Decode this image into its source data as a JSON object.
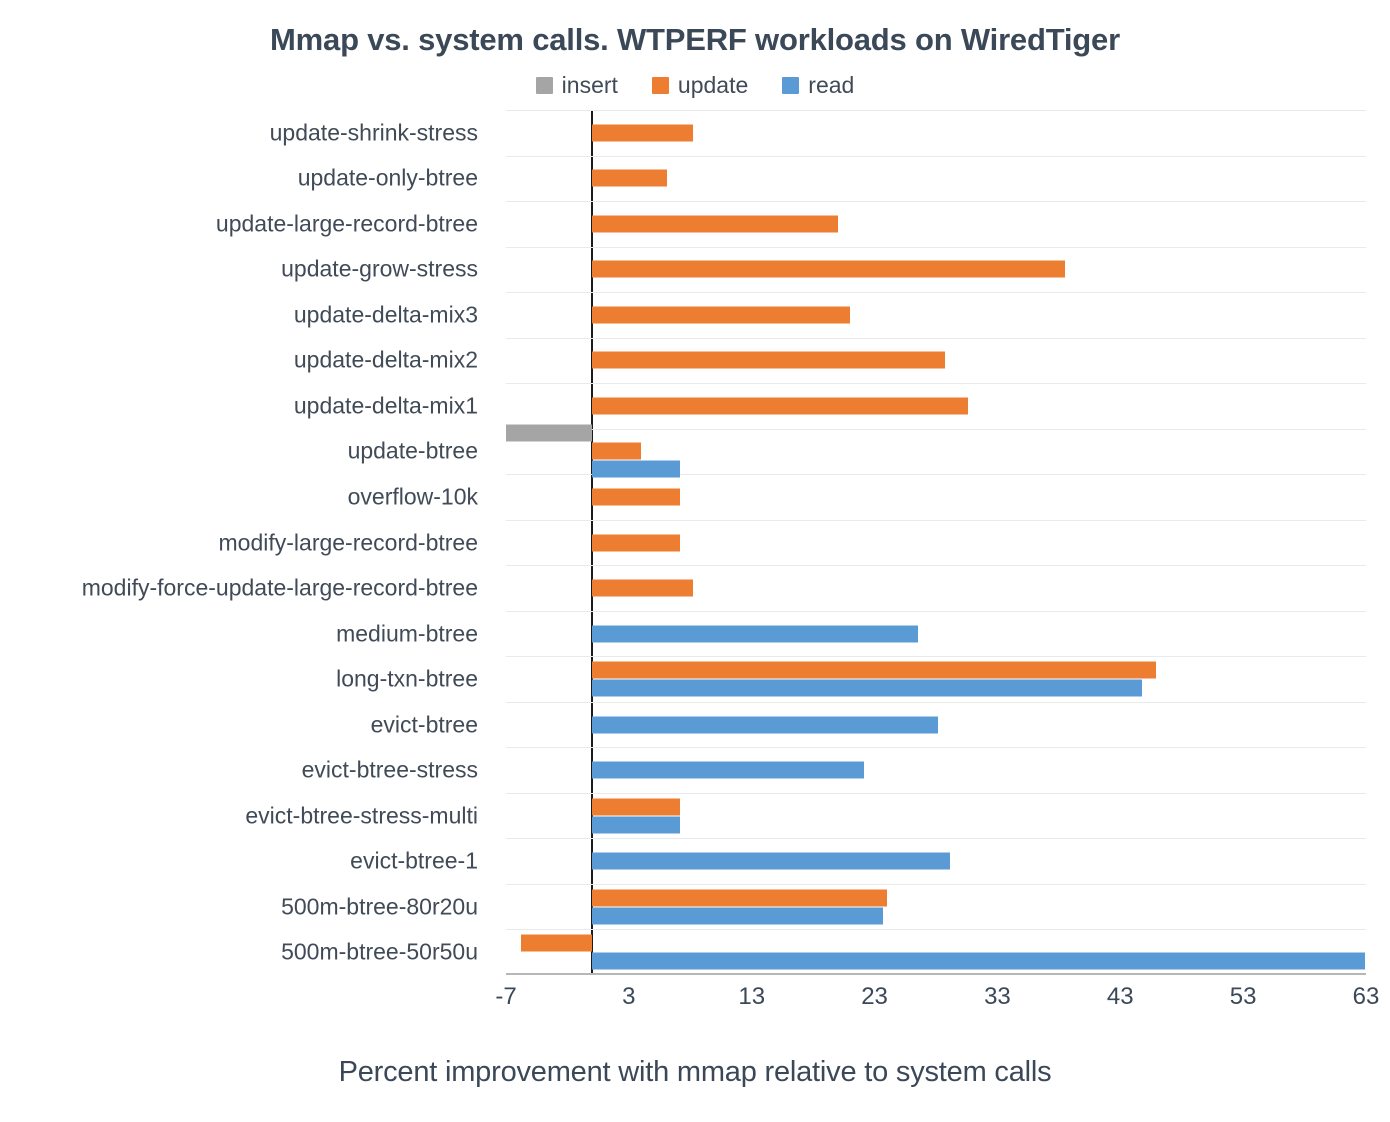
{
  "chart_data": {
    "type": "bar",
    "orientation": "horizontal",
    "title": "Mmap vs. system calls. WTPERF workloads on WiredTiger",
    "xlabel": "Percent improvement with mmap relative to system calls",
    "ylabel": "",
    "xlim": [
      -7,
      63
    ],
    "xticks": [
      -7,
      3,
      13,
      23,
      33,
      43,
      53,
      63
    ],
    "grid": "horizontal",
    "legend_position": "top-center",
    "categories": [
      "update-shrink-stress",
      "update-only-btree",
      "update-large-record-btree",
      "update-grow-stress",
      "update-delta-mix3",
      "update-delta-mix2",
      "update-delta-mix1",
      "update-btree",
      "overflow-10k",
      "modify-large-record-btree",
      "modify-force-update-large-record-btree",
      "medium-btree",
      "long-txn-btree",
      "evict-btree",
      "evict-btree-stress",
      "evict-btree-stress-multi",
      "evict-btree-1",
      "500m-btree-80r20u",
      "500m-btree-50r50u"
    ],
    "series": [
      {
        "name": "insert",
        "color": "#a5a5a5",
        "values": [
          null,
          null,
          null,
          null,
          null,
          null,
          null,
          -7.0,
          null,
          null,
          null,
          null,
          null,
          null,
          null,
          null,
          null,
          null,
          null
        ]
      },
      {
        "name": "update",
        "color": "#ed7d31",
        "values": [
          8.2,
          6.1,
          20.0,
          38.5,
          21.0,
          28.7,
          30.6,
          4.0,
          7.2,
          7.2,
          8.2,
          null,
          45.9,
          null,
          null,
          7.2,
          null,
          24.0,
          -5.8
        ]
      },
      {
        "name": "read",
        "color": "#5b9bd5",
        "values": [
          null,
          null,
          null,
          null,
          null,
          null,
          null,
          7.2,
          null,
          null,
          null,
          26.5,
          44.8,
          28.2,
          22.1,
          7.2,
          29.1,
          23.7,
          62.9
        ]
      }
    ]
  },
  "legend": {
    "items": [
      {
        "label": "insert",
        "color": "#a5a5a5"
      },
      {
        "label": "update",
        "color": "#ed7d31"
      },
      {
        "label": "read",
        "color": "#5b9bd5"
      }
    ]
  }
}
